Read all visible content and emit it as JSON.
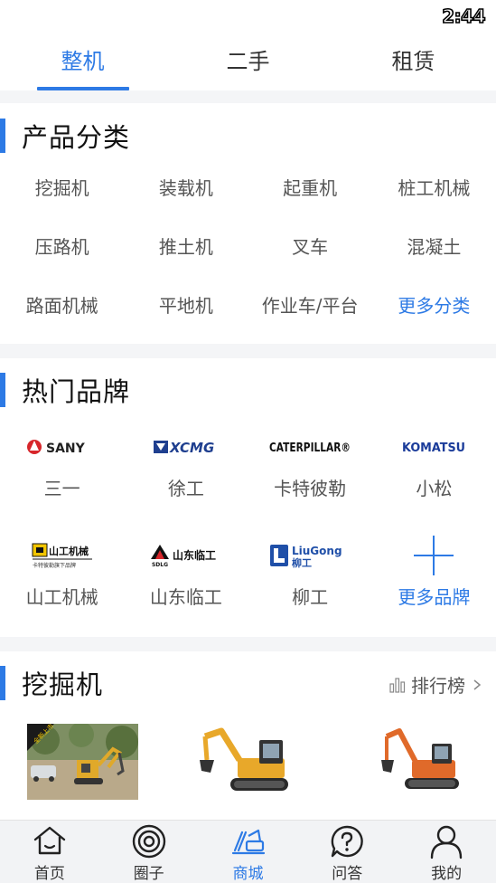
{
  "status_bar": {
    "time": "2:44"
  },
  "top_tabs": [
    {
      "label": "整机",
      "active": true
    },
    {
      "label": "二手",
      "active": false
    },
    {
      "label": "租赁",
      "active": false
    }
  ],
  "category_section": {
    "title": "产品分类",
    "items": [
      {
        "label": "挖掘机"
      },
      {
        "label": "装载机"
      },
      {
        "label": "起重机"
      },
      {
        "label": "桩工机械"
      },
      {
        "label": "压路机"
      },
      {
        "label": "推土机"
      },
      {
        "label": "叉车"
      },
      {
        "label": "混凝土"
      },
      {
        "label": "路面机械"
      },
      {
        "label": "平地机"
      },
      {
        "label": "作业车/平台"
      },
      {
        "label": "更多分类"
      }
    ]
  },
  "brand_section": {
    "title": "热门品牌",
    "brands": [
      {
        "name": "三一",
        "logo_text": "SANY"
      },
      {
        "name": "徐工",
        "logo_text": "XCMG"
      },
      {
        "name": "卡特彼勒",
        "logo_text": "CATERPILLAR®"
      },
      {
        "name": "小松",
        "logo_text": "KOMATSU"
      },
      {
        "name": "山工机械",
        "logo_text": "山工机械",
        "logo_sub": "卡特彼勒旗下品牌"
      },
      {
        "name": "山东临工",
        "logo_text": "山东临工",
        "logo_sub": "SDLG"
      },
      {
        "name": "柳工",
        "logo_text": "LiuGong",
        "logo_sub": "柳工"
      },
      {
        "name": "更多品牌"
      }
    ]
  },
  "excavator_section": {
    "title": "挖掘机",
    "rank_label": "排行榜",
    "products": [
      {
        "badge": "全新上市"
      },
      {},
      {}
    ]
  },
  "colors": {
    "accent": "#2d7ae5",
    "excavator_yellow": "#e8a82a",
    "excavator_orange": "#e06a2a"
  },
  "bottom_nav": [
    {
      "label": "首页",
      "icon": "home-icon",
      "active": false
    },
    {
      "label": "圈子",
      "icon": "circle-icon",
      "active": false
    },
    {
      "label": "商城",
      "icon": "mall-icon",
      "active": true
    },
    {
      "label": "问答",
      "icon": "question-icon",
      "active": false
    },
    {
      "label": "我的",
      "icon": "user-icon",
      "active": false
    }
  ]
}
